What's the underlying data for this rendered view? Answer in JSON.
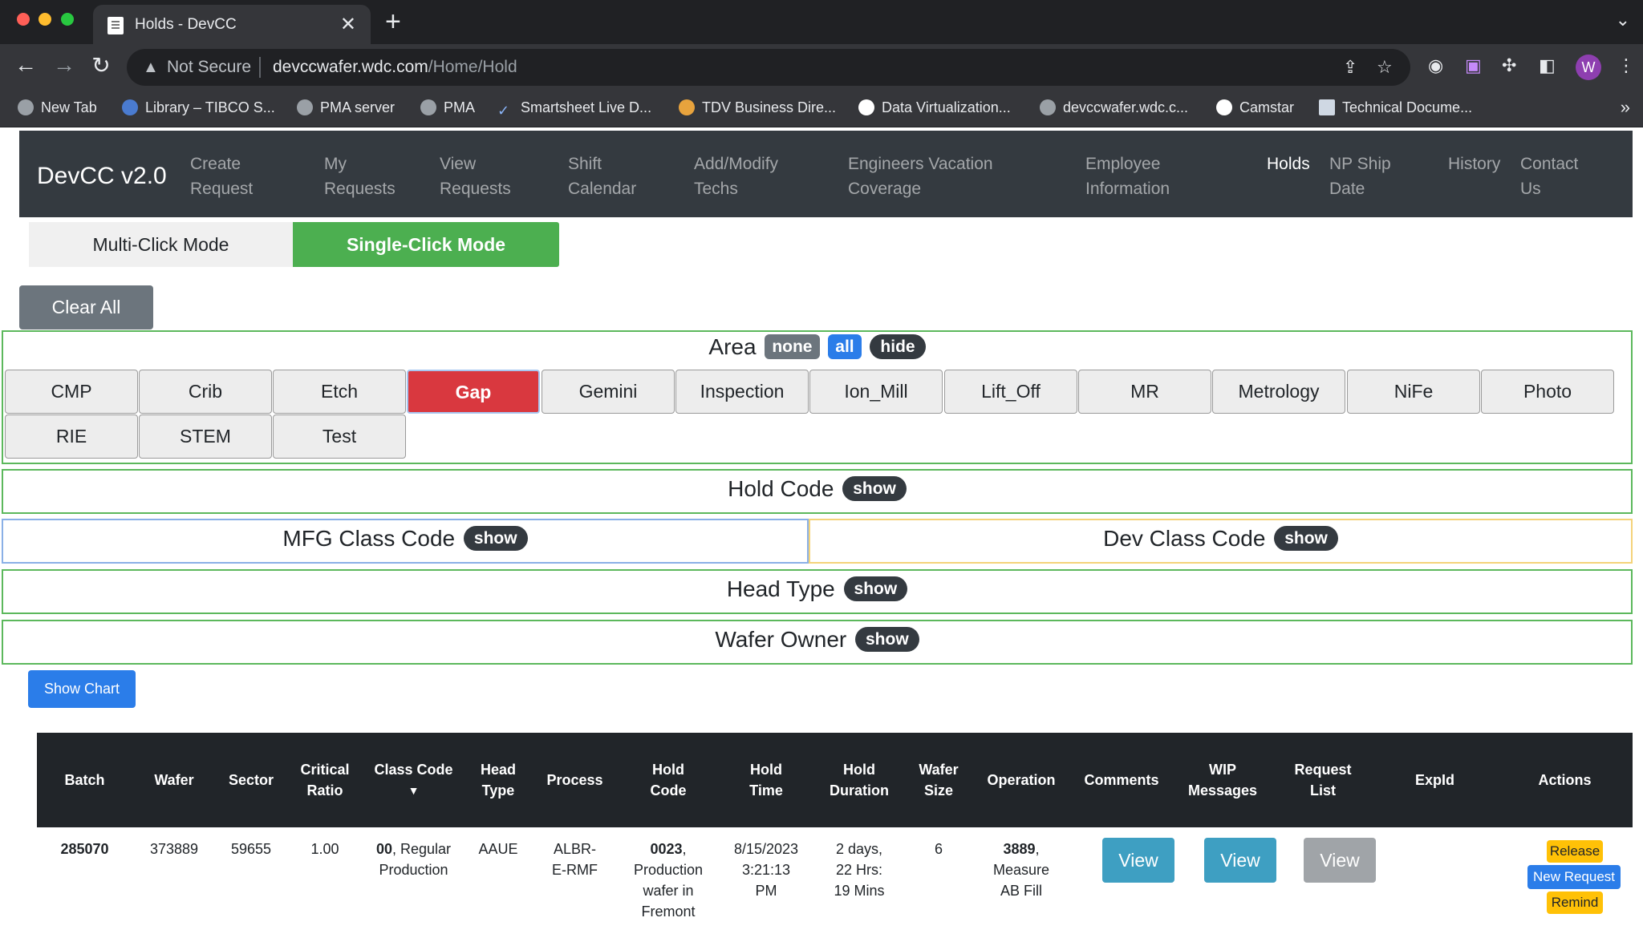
{
  "browser": {
    "tab_title": "Holds - DevCC",
    "tab_close": "✕",
    "new_tab": "+",
    "security_label": "Not Secure",
    "url_host": "devccwafer.wdc.com",
    "url_path": "/Home/Hold",
    "avatar_letter": "W",
    "bookmarks": [
      "New Tab",
      "Library – TIBCO S...",
      "PMA server",
      "PMA",
      "Smartsheet Live D...",
      "TDV Business Dire...",
      "Data Virtualization...",
      "devccwafer.wdc.c...",
      "Camstar",
      "Technical Docume..."
    ],
    "bookmarks_more": "»"
  },
  "navbar": {
    "brand": "DevCC v2.0",
    "links": [
      {
        "line1": "Create",
        "line2": "Request"
      },
      {
        "line1": "My",
        "line2": "Requests"
      },
      {
        "line1": "View",
        "line2": "Requests"
      },
      {
        "line1": "Shift",
        "line2": "Calendar"
      },
      {
        "line1": "Add/Modify",
        "line2": "Techs"
      },
      {
        "line1": "Engineers Vacation",
        "line2": "Coverage"
      },
      {
        "line1": "Employee",
        "line2": "Information"
      },
      {
        "line1": "Holds",
        "line2": ""
      },
      {
        "line1": "NP Ship",
        "line2": "Date"
      },
      {
        "line1": "History",
        "line2": ""
      },
      {
        "line1": "Contact",
        "line2": "Us"
      }
    ],
    "active_link": "Holds"
  },
  "modes": {
    "multi_label": "Multi-Click Mode",
    "single_label": "Single-Click Mode",
    "active": "Single-Click Mode"
  },
  "clear_all_label": "Clear All",
  "area": {
    "title": "Area",
    "pill_none": "none",
    "pill_all": "all",
    "pill_hide": "hide",
    "buttons": [
      "CMP",
      "Crib",
      "Etch",
      "Gap",
      "Gemini",
      "Inspection",
      "Ion_Mill",
      "Lift_Off",
      "MR",
      "Metrology",
      "NiFe",
      "Photo",
      "RIE",
      "STEM",
      "Test"
    ],
    "selected": "Gap"
  },
  "filters": {
    "hold_code": {
      "title": "Hold Code",
      "pill": "show"
    },
    "mfg_class_code": {
      "title": "MFG Class Code",
      "pill": "show"
    },
    "dev_class_code": {
      "title": "Dev Class Code",
      "pill": "show"
    },
    "head_type": {
      "title": "Head Type",
      "pill": "show"
    },
    "wafer_owner": {
      "title": "Wafer Owner",
      "pill": "show"
    }
  },
  "show_chart_label": "Show Chart",
  "table": {
    "headers": [
      {
        "l1": "Batch",
        "l2": ""
      },
      {
        "l1": "Wafer",
        "l2": ""
      },
      {
        "l1": "Sector",
        "l2": ""
      },
      {
        "l1": "Critical",
        "l2": "Ratio"
      },
      {
        "l1": "Class Code",
        "l2": "▼"
      },
      {
        "l1": "Head",
        "l2": "Type"
      },
      {
        "l1": "Process",
        "l2": ""
      },
      {
        "l1": "Hold",
        "l2": "Code"
      },
      {
        "l1": "Hold",
        "l2": "Time"
      },
      {
        "l1": "Hold",
        "l2": "Duration"
      },
      {
        "l1": "Wafer",
        "l2": "Size"
      },
      {
        "l1": "Operation",
        "l2": ""
      },
      {
        "l1": "Comments",
        "l2": ""
      },
      {
        "l1": "WIP",
        "l2": "Messages"
      },
      {
        "l1": "Request",
        "l2": "List"
      },
      {
        "l1": "ExpId",
        "l2": ""
      },
      {
        "l1": "Actions",
        "l2": ""
      }
    ],
    "rows": [
      {
        "batch": "285070",
        "wafer": "373889",
        "sector": "59655",
        "critical_ratio": "1.00",
        "class_code_num": "00",
        "class_code_desc_1": ", Regular",
        "class_code_desc_2": "Production",
        "head_type": "AAUE",
        "process_1": "ALBR-",
        "process_2": "E-RMF",
        "hold_code_num": "0023",
        "hold_code_desc_1": ",",
        "hold_code_desc_2": "Production",
        "hold_code_desc_3": "wafer in",
        "hold_code_desc_4": "Fremont",
        "hold_time_1": "8/15/2023",
        "hold_time_2": "3:21:13",
        "hold_time_3": "PM",
        "hold_duration_1": "2 days,",
        "hold_duration_2": "22 Hrs:",
        "hold_duration_3": "19 Mins",
        "wafer_size": "6",
        "operation_num": "3889",
        "operation_desc_1": ",",
        "operation_desc_2": "Measure",
        "operation_desc_3": "AB Fill",
        "comments_btn": "View",
        "wip_btn": "View",
        "request_btn": "View",
        "expid": "",
        "action_release": "Release",
        "action_new_request": "New Request",
        "action_remind": "Remind"
      }
    ]
  }
}
